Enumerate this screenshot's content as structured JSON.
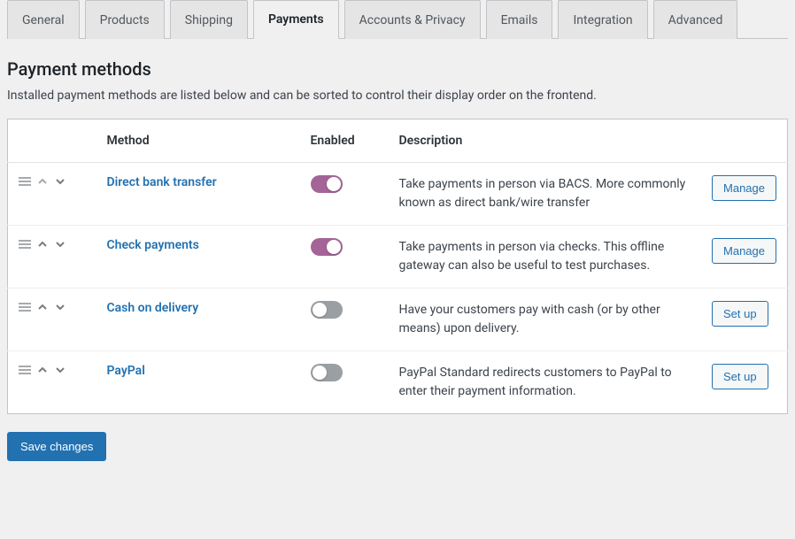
{
  "tabs": [
    {
      "label": "General"
    },
    {
      "label": "Products"
    },
    {
      "label": "Shipping"
    },
    {
      "label": "Payments"
    },
    {
      "label": "Accounts & Privacy"
    },
    {
      "label": "Emails"
    },
    {
      "label": "Integration"
    },
    {
      "label": "Advanced"
    }
  ],
  "active_tab_index": 3,
  "heading": "Payment methods",
  "subheading": "Installed payment methods are listed below and can be sorted to control their display order on the frontend.",
  "columns": {
    "method": "Method",
    "enabled": "Enabled",
    "description": "Description"
  },
  "rows": [
    {
      "name": "Direct bank transfer",
      "enabled": true,
      "up": false,
      "down": true,
      "description": "Take payments in person via BACS. More commonly known as direct bank/wire transfer",
      "action": "Manage"
    },
    {
      "name": "Check payments",
      "enabled": true,
      "up": true,
      "down": true,
      "description": "Take payments in person via checks. This offline gateway can also be useful to test purchases.",
      "action": "Manage"
    },
    {
      "name": "Cash on delivery",
      "enabled": false,
      "up": true,
      "down": true,
      "description": "Have your customers pay with cash (or by other means) upon delivery.",
      "action": "Set up"
    },
    {
      "name": "PayPal",
      "enabled": false,
      "up": true,
      "down": true,
      "description": "PayPal Standard redirects customers to PayPal to enter their payment information.",
      "action": "Set up"
    }
  ],
  "save_button": "Save changes"
}
